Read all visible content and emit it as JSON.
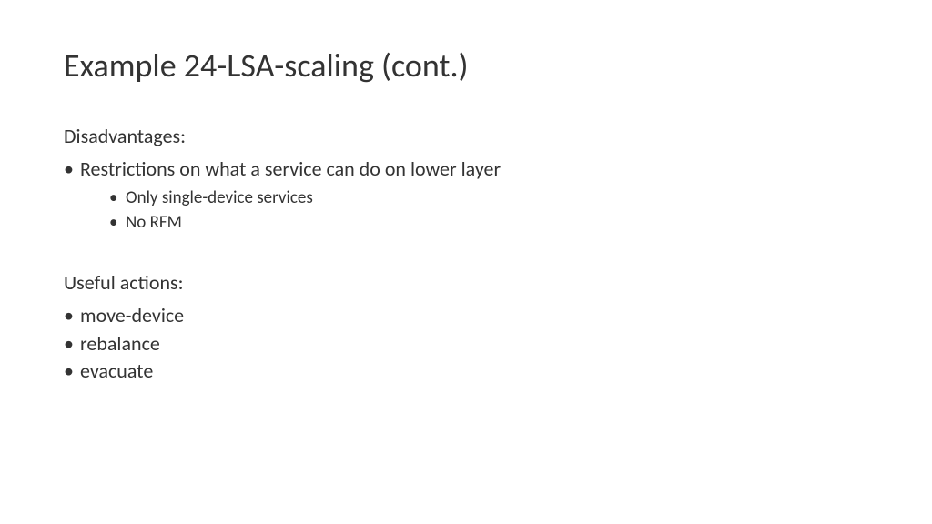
{
  "title": "Example 24-LSA-scaling (cont.)",
  "sections": [
    {
      "heading": "Disadvantages:",
      "items": [
        {
          "text": "Restrictions on what a service can do on lower layer",
          "subitems": [
            "Only single-device services",
            "No RFM"
          ]
        }
      ]
    },
    {
      "heading": "Useful actions:",
      "items": [
        {
          "text": "move-device",
          "subitems": []
        },
        {
          "text": "rebalance",
          "subitems": []
        },
        {
          "text": "evacuate",
          "subitems": []
        }
      ]
    }
  ]
}
